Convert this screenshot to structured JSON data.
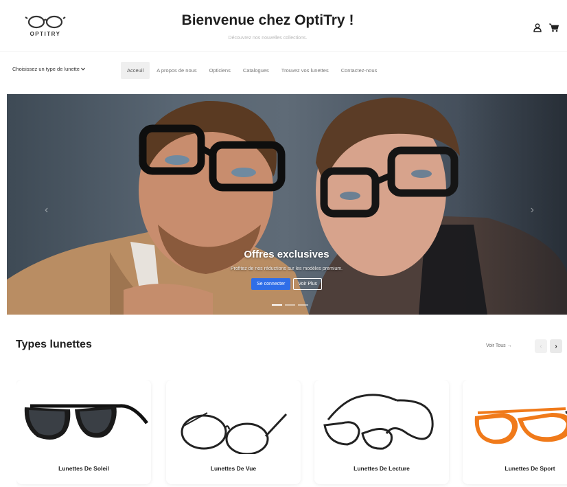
{
  "header": {
    "logo_text": "OPTITRY",
    "title": "Bienvenue chez OptiTry !",
    "subtitle": "Découvrez nos nouvelles collections.",
    "icons": [
      "user-icon",
      "cart-icon"
    ]
  },
  "nav": {
    "type_select": "Choisissez un type de lunette",
    "links": [
      "Acceuil",
      "A propos de nous",
      "Opticiens",
      "Catalogues",
      "Trouvez vos lunettes",
      "Contactez-nous"
    ],
    "active_index": 0
  },
  "hero": {
    "title": "Offres exclusives",
    "text": "Profitez de nos réductions sur les modèles premium.",
    "primary_button": "Se connecter",
    "secondary_button": "Voir Plus",
    "slide_count": 3,
    "active_slide": 0
  },
  "types": {
    "title": "Types lunettes",
    "see_all": "Voir Tous →",
    "items": [
      {
        "label": "Lunettes De Soleil",
        "icon": "sunglasses-icon"
      },
      {
        "label": "Lunettes De Vue",
        "icon": "eyeglasses-icon"
      },
      {
        "label": "Lunettes De Lecture",
        "icon": "reading-glasses-icon"
      },
      {
        "label": "Lunettes De Sport",
        "icon": "sport-glasses-icon"
      }
    ]
  },
  "colors": {
    "primary_button": "#2f6ee8",
    "sport_frame": "#f07a1a"
  }
}
